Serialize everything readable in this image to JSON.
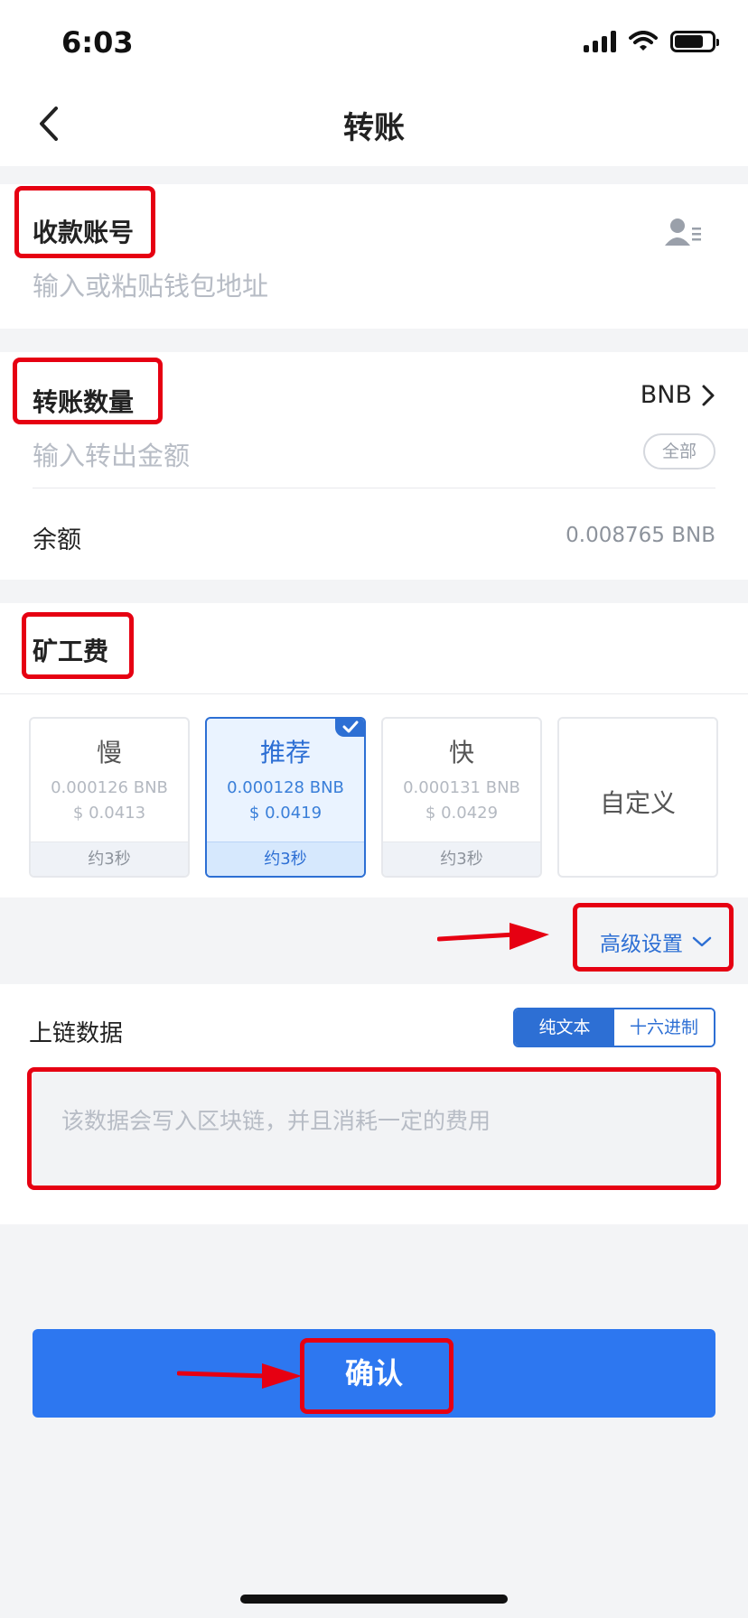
{
  "status_bar": {
    "time": "6:03"
  },
  "nav": {
    "title": "转账"
  },
  "recipient": {
    "label": "收款账号",
    "placeholder": "输入或粘贴钱包地址"
  },
  "amount": {
    "label": "转账数量",
    "token": "BNB",
    "placeholder": "输入转出金额",
    "all_label": "全部",
    "balance_label": "余额",
    "balance_value": "0.008765 BNB"
  },
  "fee": {
    "label": "矿工费",
    "options": [
      {
        "name": "慢",
        "amount": "0.000126 BNB",
        "usd": "$ 0.0413",
        "eta": "约3秒",
        "selected": false
      },
      {
        "name": "推荐",
        "amount": "0.000128 BNB",
        "usd": "$ 0.0419",
        "eta": "约3秒",
        "selected": true
      },
      {
        "name": "快",
        "amount": "0.000131 BNB",
        "usd": "$ 0.0429",
        "eta": "约3秒",
        "selected": false
      }
    ],
    "custom_label": "自定义",
    "advanced_label": "高级设置"
  },
  "chain_data": {
    "label": "上链数据",
    "mode_text": "纯文本",
    "mode_hex": "十六进制",
    "placeholder": "该数据会写入区块链，并且消耗一定的费用"
  },
  "confirm_label": "确认",
  "colors": {
    "accent": "#2d77f0",
    "annotation": "#e60012"
  }
}
